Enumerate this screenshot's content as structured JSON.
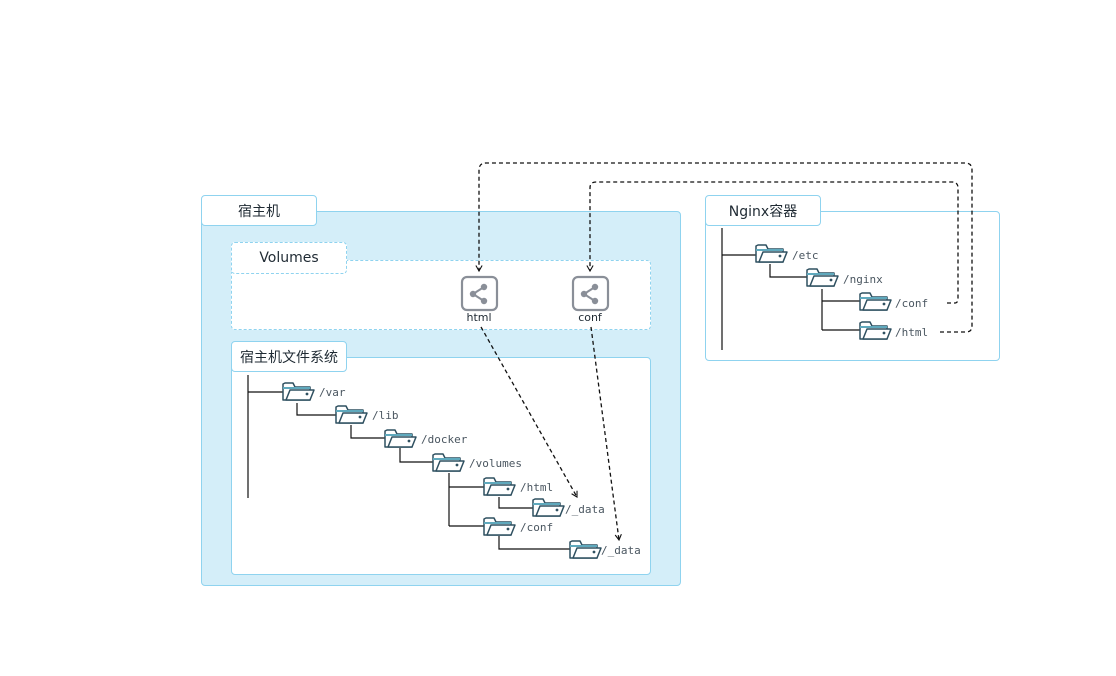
{
  "host": {
    "title": "宿主机"
  },
  "volumes": {
    "title": "Volumes",
    "items": [
      {
        "label": "html",
        "icon": "share-icon"
      },
      {
        "label": "conf",
        "icon": "share-icon"
      }
    ]
  },
  "host_fs": {
    "title": "宿主机文件系统",
    "folders": [
      "/var",
      "/lib",
      "/docker",
      "/volumes",
      "/html",
      "/_data",
      "/conf",
      "/_data"
    ]
  },
  "nginx": {
    "title": "Nginx容器",
    "folders": [
      "/etc",
      "/nginx",
      "/conf",
      "/html"
    ]
  },
  "colors": {
    "panel_fill": "#d4eef9",
    "panel_border": "#8fd3ef",
    "folder_stroke": "#2f5060",
    "folder_tab": "#5fa9bd",
    "volume_icon": "#8a8f98"
  }
}
